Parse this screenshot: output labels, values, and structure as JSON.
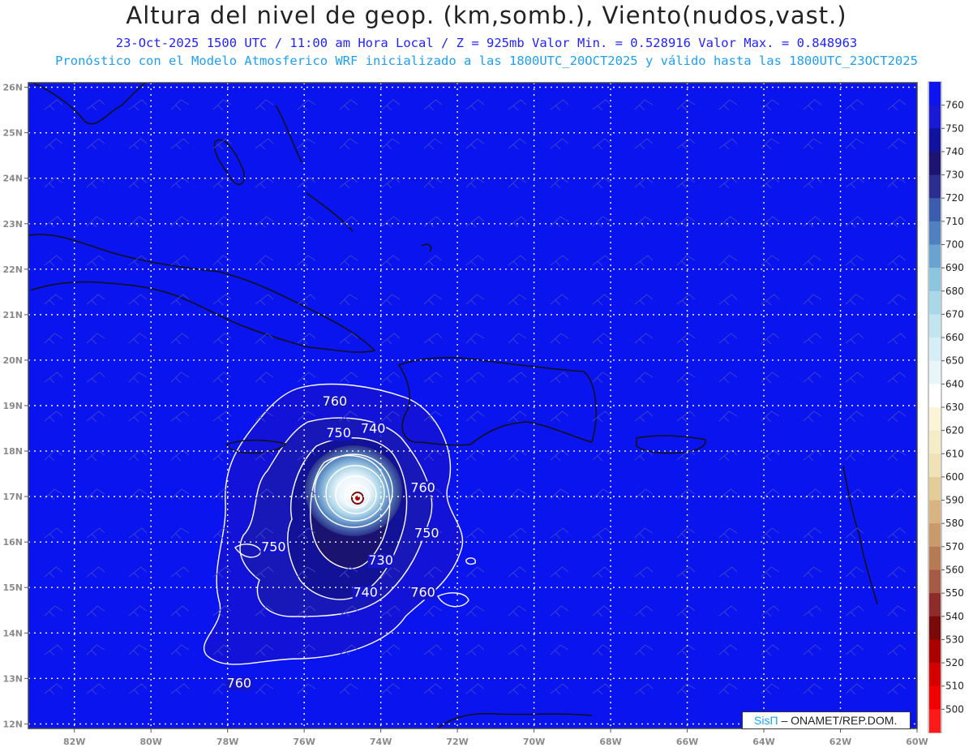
{
  "header": {
    "title": "Altura del nivel de geop. (km,somb.), Viento(nudos,vast.)",
    "subtitle_1": "23-Oct-2025  1500 UTC / 11:00 am Hora Local / Z = 925mb  Valor Min. = 0.528916  Valor Max. = 0.848963",
    "subtitle_2": "Pronóstico con el Modelo Atmosferico WRF inicializado a las 1800UTC_20OCT2025 y válido hasta las  1800UTC_23OCT2025"
  },
  "map": {
    "lon_range": [
      -83.2,
      -60
    ],
    "lat_range": [
      11.9,
      26.1
    ],
    "lon_ticks": [
      "82W",
      "80W",
      "78W",
      "76W",
      "74W",
      "72W",
      "70W",
      "68W",
      "66W",
      "64W",
      "62W",
      "60W"
    ],
    "lat_ticks": [
      "12N",
      "13N",
      "14N",
      "15N",
      "16N",
      "17N",
      "18N",
      "19N",
      "20N",
      "21N",
      "22N",
      "23N",
      "24N",
      "25N",
      "26N"
    ],
    "background_color": "#0a14ee",
    "grid_style": "dotted white",
    "contour_labels": [
      {
        "text": "760",
        "lon": -75.2,
        "lat": 19.0
      },
      {
        "text": "750",
        "lon": -75.1,
        "lat": 18.3
      },
      {
        "text": "740",
        "lon": -74.2,
        "lat": 18.4
      },
      {
        "text": "760",
        "lon": -72.9,
        "lat": 17.1
      },
      {
        "text": "750",
        "lon": -72.8,
        "lat": 16.1
      },
      {
        "text": "750",
        "lon": -76.8,
        "lat": 15.8
      },
      {
        "text": "730",
        "lon": -74.0,
        "lat": 15.5
      },
      {
        "text": "740",
        "lon": -74.4,
        "lat": 14.8
      },
      {
        "text": "760",
        "lon": -72.9,
        "lat": 14.8
      },
      {
        "text": "760",
        "lon": -77.7,
        "lat": 12.8
      }
    ]
  },
  "colorbar": {
    "levels": [
      {
        "label": "760",
        "color": "#0d14f0"
      },
      {
        "label": "750",
        "color": "#1a1ad4"
      },
      {
        "label": "740",
        "color": "#11139e"
      },
      {
        "label": "730",
        "color": "#1c1470"
      },
      {
        "label": "720",
        "color": "#2b2e8f"
      },
      {
        "label": "710",
        "color": "#3c5dad"
      },
      {
        "label": "700",
        "color": "#5080c0"
      },
      {
        "label": "690",
        "color": "#6aa2d0"
      },
      {
        "label": "680",
        "color": "#8dc4de"
      },
      {
        "label": "670",
        "color": "#a9d8e9"
      },
      {
        "label": "660",
        "color": "#c2e6f0"
      },
      {
        "label": "650",
        "color": "#d6eef5"
      },
      {
        "label": "640",
        "color": "#e8f6f9"
      },
      {
        "label": "630",
        "color": "#ffffff"
      },
      {
        "label": "620",
        "color": "#fbf4d8"
      },
      {
        "label": "610",
        "color": "#f5ecc8"
      },
      {
        "label": "600",
        "color": "#efe2b4"
      },
      {
        "label": "590",
        "color": "#e5cd9a"
      },
      {
        "label": "580",
        "color": "#d8b482"
      },
      {
        "label": "570",
        "color": "#c99a6a"
      },
      {
        "label": "560",
        "color": "#b67b55"
      },
      {
        "label": "550",
        "color": "#a45a44"
      },
      {
        "label": "540",
        "color": "#8e2c2c"
      },
      {
        "label": "530",
        "color": "#7a0a0a"
      },
      {
        "label": "520",
        "color": "#aa0000"
      },
      {
        "label": "510",
        "color": "#d40000"
      },
      {
        "label": "500",
        "color": "#f00000"
      },
      {
        "label": "",
        "color": "#ff1a1a"
      }
    ]
  },
  "credit": {
    "brand": "SisΠ",
    "org": "– ONAMET/REP.DOM."
  }
}
